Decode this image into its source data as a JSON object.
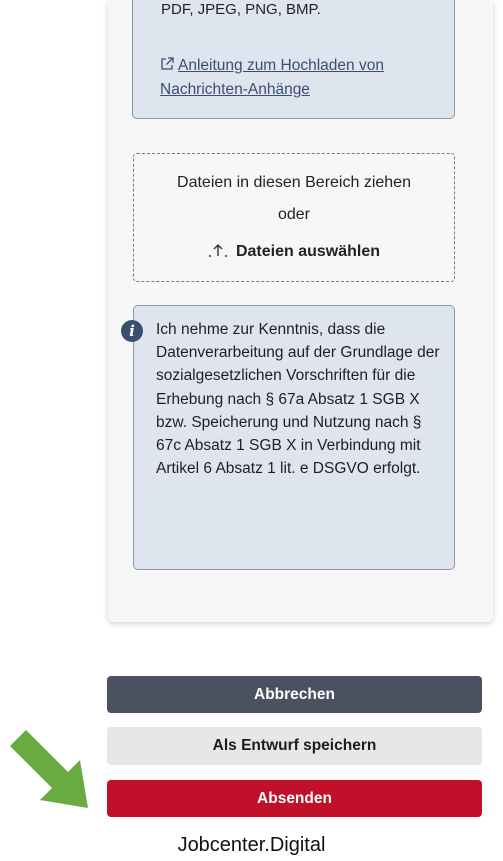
{
  "upload_info": {
    "file_types": "PDF, JPEG, PNG, BMP.",
    "guide_link": "Anleitung zum Hochladen von Nachrichten-Anhänge"
  },
  "dropzone": {
    "line1": "Dateien in diesen Bereich ziehen",
    "line2": "oder",
    "select_label": "Dateien auswählen"
  },
  "notice": {
    "text": "Ich nehme zur Kenntnis, dass die Datenverarbeitung auf der Grundlage der sozialgesetzlichen Vorschriften für die Erhebung nach § 67a Absatz 1 SGB X bzw. Speicherung und Nutzung nach § 67c Absatz 1 SGB X in Verbindung mit Artikel 6 Absatz 1 lit. e DSGVO erfolgt."
  },
  "actions": {
    "cancel": "Abbrechen",
    "save_draft": "Als Entwurf speichern",
    "send": "Absenden"
  },
  "footer": {
    "caption": "Jobcenter.Digital"
  },
  "colors": {
    "cancel_bg": "#4a5261",
    "send_bg": "#c0102a",
    "notice_bg": "#dfe5ee",
    "arrow": "#6aab3f"
  },
  "icons": {
    "external_link": "external-link-icon",
    "upload": "upload-icon",
    "info": "info-icon",
    "pointer_arrow": "arrow-icon"
  }
}
